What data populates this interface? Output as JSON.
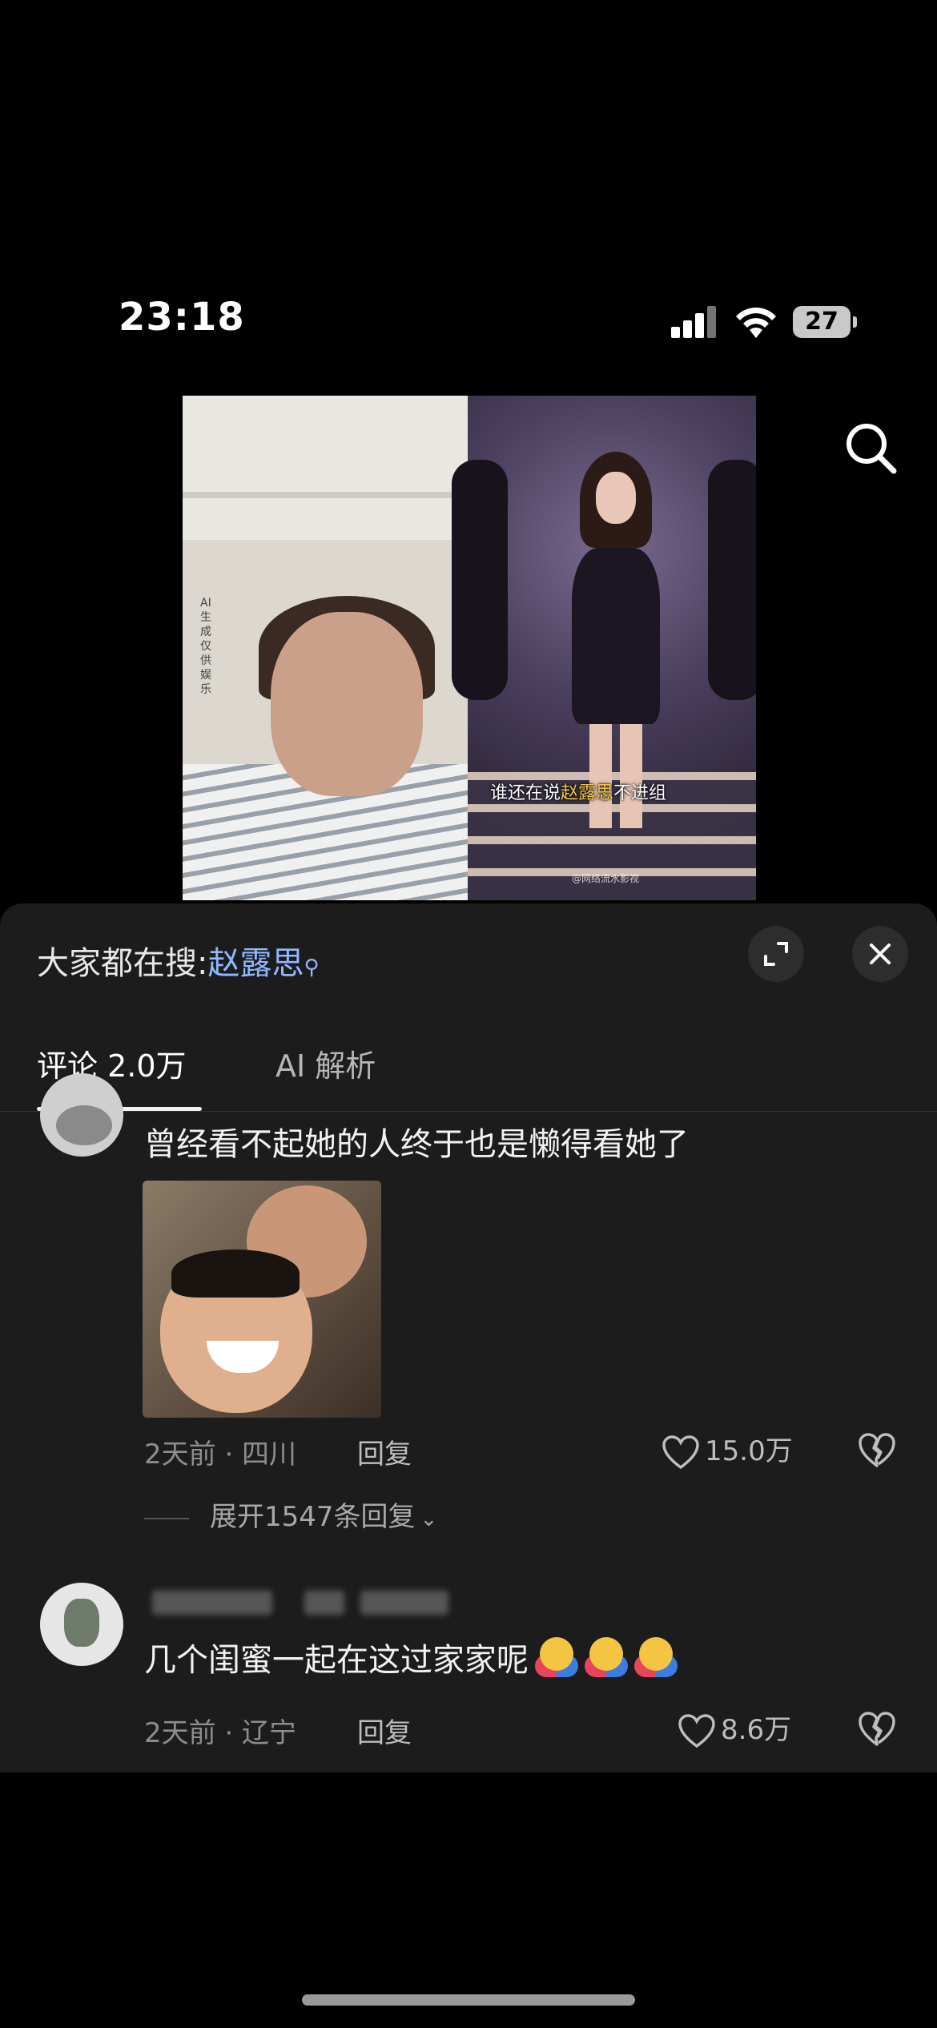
{
  "status_bar": {
    "time": "23:18",
    "battery": "27",
    "icons": [
      "signal-icon",
      "wifi-icon",
      "battery-icon"
    ]
  },
  "top_bar": {
    "icon": "search-icon"
  },
  "video": {
    "left_side_mark": "AI生成 仅供娱乐",
    "subtitle_prefix": "谁还在说",
    "subtitle_highlight": "赵露思",
    "subtitle_suffix": "不进组",
    "watermark": "@网络流水影视"
  },
  "panel": {
    "trending_prefix": "大家都在搜:",
    "trending_keyword": "赵露思",
    "trending_icon": "search-icon",
    "buttons": [
      "expand-icon",
      "close-icon"
    ],
    "tabs": [
      {
        "label": "评论 2.0万",
        "active": true
      },
      {
        "label": "AI 解析",
        "active": false
      }
    ]
  },
  "comments": [
    {
      "text": "曾经看不起她的人终于也是懒得看她了",
      "meta": "2天前 · 四川",
      "reply_label": "回复",
      "likes": "15.0万",
      "expand_replies": "展开1547条回复"
    },
    {
      "text": "几个闺蜜一起在这过家家呢",
      "meta": "2天前 · 辽宁",
      "reply_label": "回复",
      "likes": "8.6万"
    }
  ],
  "colors": {
    "panel_bg": "#1c1c1c",
    "keyword": "#8fb8ff",
    "subtitle_highlight": "#f3c64a"
  }
}
